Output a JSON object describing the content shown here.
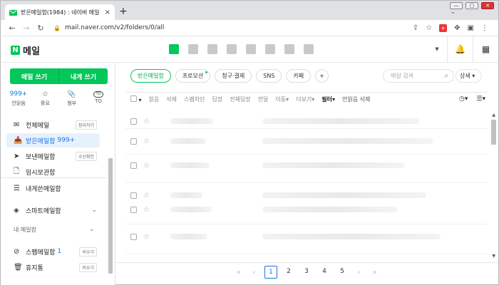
{
  "browser": {
    "tab_title": "받은메일함(1984) : 네이버 메일",
    "tab_close": "×",
    "new_tab": "+",
    "url": "mail.naver.com/v2/folders/0/all",
    "back": "←",
    "forward": "→",
    "reload": "↻",
    "win_minimize": "—",
    "win_restore": "▢",
    "win_close": "✕"
  },
  "header": {
    "logo_letter": "N",
    "logo_text": "메일",
    "services": [
      "mail",
      "calendar",
      "contacts",
      "memo",
      "office",
      "photo",
      "mybox",
      "bookmark"
    ]
  },
  "sidebar": {
    "write_button": "메일 쓰기",
    "write_to_me_button": "내게 쓰기",
    "quick": [
      {
        "value": "999+",
        "label": "안읽음"
      },
      {
        "icon": "☆",
        "label": "중요"
      },
      {
        "icon": "📎",
        "label": "첨부"
      },
      {
        "icon": "TO",
        "label": "TO"
      }
    ],
    "folders": [
      {
        "label": "전체메일",
        "badge": "정리하기"
      },
      {
        "label": "받은메일함",
        "count": "999+"
      },
      {
        "label": "보낸메일함",
        "badge": "수신확인"
      },
      {
        "label": "임시보관함"
      },
      {
        "label": "내게쓴메일함"
      },
      {
        "label": "스마트메일함"
      }
    ],
    "section_title": "내 메일함",
    "bottom_folders": [
      {
        "label": "스팸메일함",
        "count": "1",
        "badge": "비우기"
      },
      {
        "label": "휴지통",
        "badge": "비우기"
      }
    ]
  },
  "main": {
    "filters": [
      "받은메일함",
      "프로모션",
      "청구·결제",
      "SNS",
      "카페"
    ],
    "search_placeholder": "메일 검색",
    "detail_label": "상세",
    "actions": [
      "읽음",
      "삭제",
      "스팸차단",
      "답장",
      "전체답장",
      "전달",
      "이동",
      "더보기",
      "필터",
      "안읽음 삭제"
    ],
    "pages": [
      "1",
      "2",
      "3",
      "4",
      "5"
    ]
  }
}
